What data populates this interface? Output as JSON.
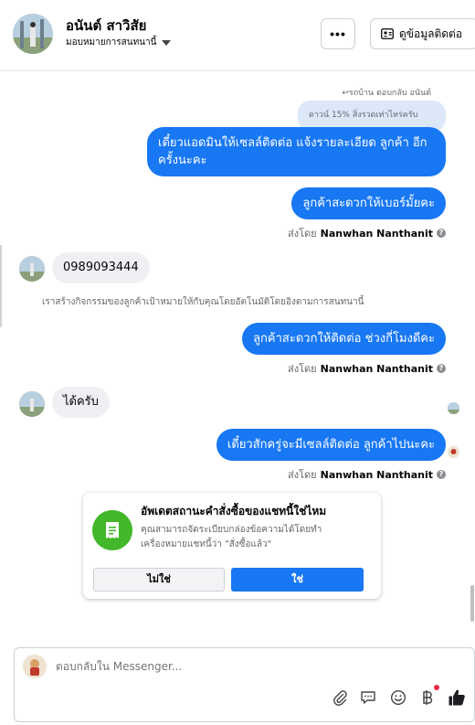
{
  "header": {
    "contact_name": "อนันต์ สาวิสัย",
    "assign_label": "มอบหมายการสนทนานี้",
    "more_label": "•••",
    "contact_info_label": "ดูข้อมูลติดต่อ"
  },
  "thread": {
    "reply_meta": "รถบ้าน ตอบกลับ อนันต์",
    "quoted_text": "ดาวน์ 15% สิ่งรวดเท่าไหร่ครับ",
    "msg1": "เดี๋ยวแอดมินให้เซลล์ติดต่อ แจ้งรายละเอียด ลูกค้า อีกครั้งนะคะ",
    "msg2": "ลูกค้าสะดวกให้เบอร์มั้ยคะ",
    "sent_by_prefix": "ส่งโดย",
    "sender_name": "Nanwhan Nanthanit",
    "incoming_phone": "0989093444",
    "system_note": "เราสร้างกิจกรรมของลูกค้าเป้าหมายให้กับคุณโดยอัตโนมัติโดยอิงตามการสนทนานี้",
    "msg3": "ลูกค้าสะดวกให้ติดต่อ ช่วงกี่โมงดีคะ",
    "incoming_reply": "ได้ครับ",
    "msg4": "เดี๋ยวสักครู่จะมีเซลล์ติดต่อ ลูกค้าไปนะคะ"
  },
  "order_card": {
    "title": "อัพเดตสถานะคำสั่งซื้อของแชทนี้ใช่ไหม",
    "description": "คุณสามารถจัดระเบียบกล่องข้อความได้โดยทำเครื่องหมายแชทนี้ว่า \"สั่งซื้อแล้ว\"",
    "no_label": "ไม่ใช่",
    "yes_label": "ใช่",
    "icon": "receipt-icon"
  },
  "composer": {
    "placeholder": "ตอบกลับใน Messenger...",
    "tools": [
      "attach-icon",
      "saved-reply-icon",
      "emoji-icon",
      "baht-icon",
      "like-icon"
    ]
  },
  "colors": {
    "accent": "#1877f2",
    "bubble_in": "#eef0f3",
    "quoted": "#dce8f8",
    "card_icon": "#42b72a"
  }
}
